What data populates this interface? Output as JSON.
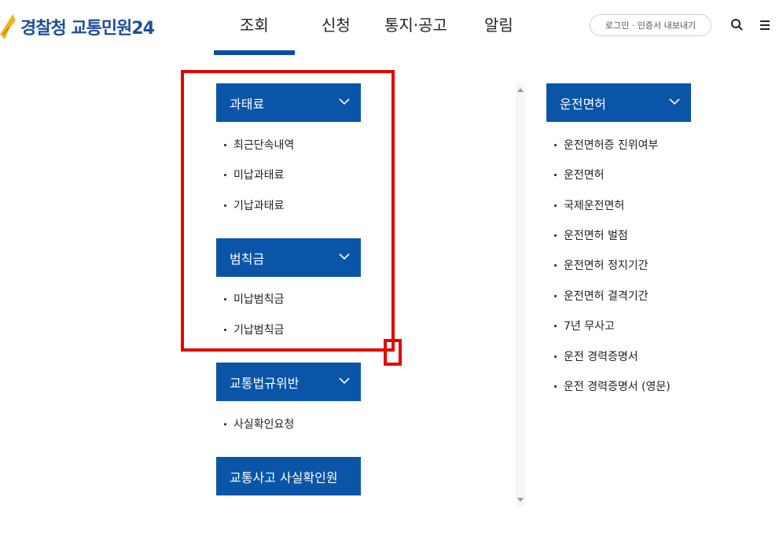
{
  "header": {
    "logo_text": "경찰청 교통민원24",
    "nav": [
      "조회",
      "신청",
      "통지·공고",
      "알림"
    ],
    "login_label": "로그인 · 인증서 내보내기",
    "accent_color": "#0a55a8"
  },
  "left_menu": {
    "fine": {
      "title": "과태료",
      "items": [
        "최근단속내역",
        "미납과태료",
        "기납과태료"
      ]
    },
    "penalty": {
      "title": "범칙금",
      "items": [
        "미납범칙금",
        "기납범칙금"
      ]
    },
    "violation": {
      "title": "교통법규위반",
      "items": [
        "사실확인요청"
      ]
    },
    "accident": {
      "title": "교통사고 사실확인원"
    }
  },
  "right_menu": {
    "license": {
      "title": "운전면허",
      "items": [
        "운전면허증 진위여부",
        "운전면허",
        "국제운전면허",
        "운전면허 벌점",
        "운전면허 정지기간",
        "운전면허 결격기간",
        "7년 무사고",
        "운전 경력증명서",
        "운전 경력증명서 (영문)"
      ]
    }
  },
  "icons": {
    "search": "search-icon",
    "menu": "hamburger-icon",
    "chevron": "chevron-down-icon"
  },
  "highlight_color": "#e60000"
}
